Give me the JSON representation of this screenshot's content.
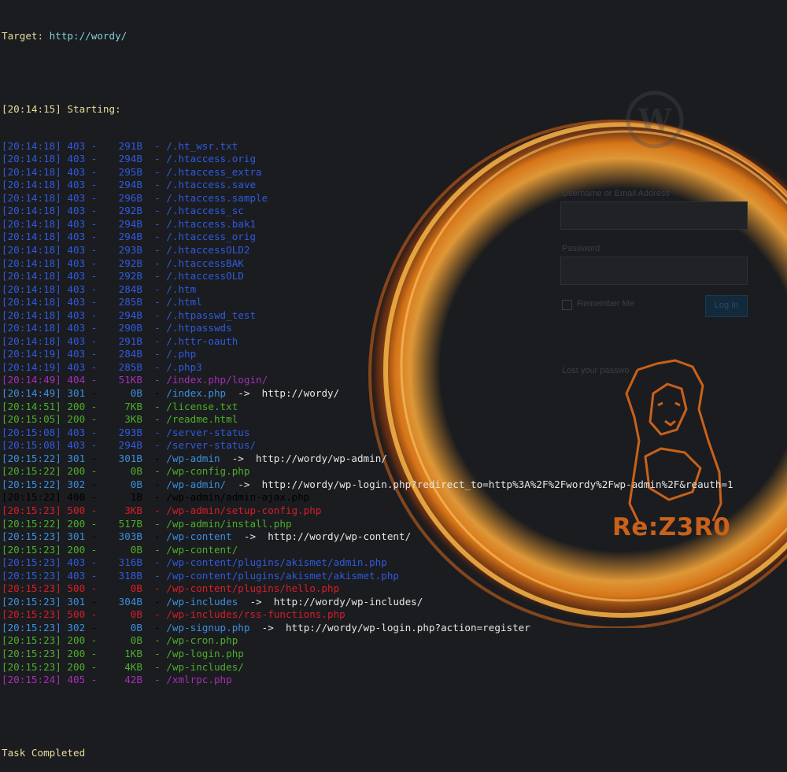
{
  "header": {
    "target_label": "Target:",
    "target_url": "http://wordy/",
    "start_time": "[20:14:15]",
    "start_label": "Starting:"
  },
  "rows": [
    {
      "ts": "[20:14:18]",
      "code": "403",
      "size": "291B",
      "path": "/.ht_wsr.txt",
      "redirect": ""
    },
    {
      "ts": "[20:14:18]",
      "code": "403",
      "size": "294B",
      "path": "/.htaccess.orig",
      "redirect": ""
    },
    {
      "ts": "[20:14:18]",
      "code": "403",
      "size": "295B",
      "path": "/.htaccess_extra",
      "redirect": ""
    },
    {
      "ts": "[20:14:18]",
      "code": "403",
      "size": "294B",
      "path": "/.htaccess.save",
      "redirect": ""
    },
    {
      "ts": "[20:14:18]",
      "code": "403",
      "size": "296B",
      "path": "/.htaccess.sample",
      "redirect": ""
    },
    {
      "ts": "[20:14:18]",
      "code": "403",
      "size": "292B",
      "path": "/.htaccess_sc",
      "redirect": ""
    },
    {
      "ts": "[20:14:18]",
      "code": "403",
      "size": "294B",
      "path": "/.htaccess.bak1",
      "redirect": ""
    },
    {
      "ts": "[20:14:18]",
      "code": "403",
      "size": "294B",
      "path": "/.htaccess_orig",
      "redirect": ""
    },
    {
      "ts": "[20:14:18]",
      "code": "403",
      "size": "293B",
      "path": "/.htaccessOLD2",
      "redirect": ""
    },
    {
      "ts": "[20:14:18]",
      "code": "403",
      "size": "292B",
      "path": "/.htaccessBAK",
      "redirect": ""
    },
    {
      "ts": "[20:14:18]",
      "code": "403",
      "size": "292B",
      "path": "/.htaccessOLD",
      "redirect": ""
    },
    {
      "ts": "[20:14:18]",
      "code": "403",
      "size": "284B",
      "path": "/.htm",
      "redirect": ""
    },
    {
      "ts": "[20:14:18]",
      "code": "403",
      "size": "285B",
      "path": "/.html",
      "redirect": ""
    },
    {
      "ts": "[20:14:18]",
      "code": "403",
      "size": "294B",
      "path": "/.htpasswd_test",
      "redirect": ""
    },
    {
      "ts": "[20:14:18]",
      "code": "403",
      "size": "290B",
      "path": "/.htpasswds",
      "redirect": ""
    },
    {
      "ts": "[20:14:18]",
      "code": "403",
      "size": "291B",
      "path": "/.httr-oauth",
      "redirect": ""
    },
    {
      "ts": "[20:14:19]",
      "code": "403",
      "size": "284B",
      "path": "/.php",
      "redirect": ""
    },
    {
      "ts": "[20:14:19]",
      "code": "403",
      "size": "285B",
      "path": "/.php3",
      "redirect": ""
    },
    {
      "ts": "[20:14:49]",
      "code": "404",
      "size": "51KB",
      "path": "/index.php/login/",
      "redirect": ""
    },
    {
      "ts": "[20:14:49]",
      "code": "301",
      "size": "0B",
      "path": "/index.php",
      "redirect": "http://wordy/"
    },
    {
      "ts": "[20:14:51]",
      "code": "200",
      "size": "7KB",
      "path": "/license.txt",
      "redirect": ""
    },
    {
      "ts": "[20:15:05]",
      "code": "200",
      "size": "3KB",
      "path": "/readme.html",
      "redirect": ""
    },
    {
      "ts": "[20:15:08]",
      "code": "403",
      "size": "293B",
      "path": "/server-status",
      "redirect": ""
    },
    {
      "ts": "[20:15:08]",
      "code": "403",
      "size": "294B",
      "path": "/server-status/",
      "redirect": ""
    },
    {
      "ts": "[20:15:22]",
      "code": "301",
      "size": "301B",
      "path": "/wp-admin",
      "redirect": "http://wordy/wp-admin/"
    },
    {
      "ts": "[20:15:22]",
      "code": "200",
      "size": "0B",
      "path": "/wp-config.php",
      "redirect": ""
    },
    {
      "ts": "[20:15:22]",
      "code": "302",
      "size": "0B",
      "path": "/wp-admin/",
      "redirect": "http://wordy/wp-login.php?redirect_to=http%3A%2F%2Fwordy%2Fwp-admin%2F&reauth=1"
    },
    {
      "ts": "[20:15:22]",
      "code": "400",
      "size": "1B",
      "path": "/wp-admin/admin-ajax.php",
      "redirect": ""
    },
    {
      "ts": "[20:15:23]",
      "code": "500",
      "size": "3KB",
      "path": "/wp-admin/setup-config.php",
      "redirect": ""
    },
    {
      "ts": "[20:15:22]",
      "code": "200",
      "size": "517B",
      "path": "/wp-admin/install.php",
      "redirect": ""
    },
    {
      "ts": "[20:15:23]",
      "code": "301",
      "size": "303B",
      "path": "/wp-content",
      "redirect": "http://wordy/wp-content/"
    },
    {
      "ts": "[20:15:23]",
      "code": "200",
      "size": "0B",
      "path": "/wp-content/",
      "redirect": ""
    },
    {
      "ts": "[20:15:23]",
      "code": "403",
      "size": "316B",
      "path": "/wp-content/plugins/akismet/admin.php",
      "redirect": ""
    },
    {
      "ts": "[20:15:23]",
      "code": "403",
      "size": "318B",
      "path": "/wp-content/plugins/akismet/akismet.php",
      "redirect": ""
    },
    {
      "ts": "[20:15:23]",
      "code": "500",
      "size": "0B",
      "path": "/wp-content/plugins/hello.php",
      "redirect": ""
    },
    {
      "ts": "[20:15:23]",
      "code": "301",
      "size": "304B",
      "path": "/wp-includes",
      "redirect": "http://wordy/wp-includes/"
    },
    {
      "ts": "[20:15:23]",
      "code": "500",
      "size": "0B",
      "path": "/wp-includes/rss-functions.php",
      "redirect": ""
    },
    {
      "ts": "[20:15:23]",
      "code": "302",
      "size": "0B",
      "path": "/wp-signup.php",
      "redirect": "http://wordy/wp-login.php?action=register"
    },
    {
      "ts": "[20:15:23]",
      "code": "200",
      "size": "0B",
      "path": "/wp-cron.php",
      "redirect": ""
    },
    {
      "ts": "[20:15:23]",
      "code": "200",
      "size": "1KB",
      "path": "/wp-login.php",
      "redirect": ""
    },
    {
      "ts": "[20:15:23]",
      "code": "200",
      "size": "4KB",
      "path": "/wp-includes/",
      "redirect": ""
    },
    {
      "ts": "[20:15:24]",
      "code": "405",
      "size": "42B",
      "path": "/xmlrpc.php",
      "redirect": ""
    }
  ],
  "footer": {
    "task_label": "Task Completed"
  },
  "background": {
    "login_username_label": "Username or Email Address",
    "login_password_label": "Password",
    "remember_label": "Remember Me",
    "login_button": "Log In",
    "lost_password": "Lost your passwo",
    "brand": "Re:Z3R0"
  },
  "colors": {
    "c403": "#2f5ae0",
    "c404": "#a330b8",
    "c301": "#3b8fe0",
    "c200": "#4caf2a",
    "c500": "#d61e2a",
    "header": "#e8dc9c",
    "target_url": "#7fd0d8",
    "ring": "#f09a2a",
    "brand": "#c9611a"
  }
}
